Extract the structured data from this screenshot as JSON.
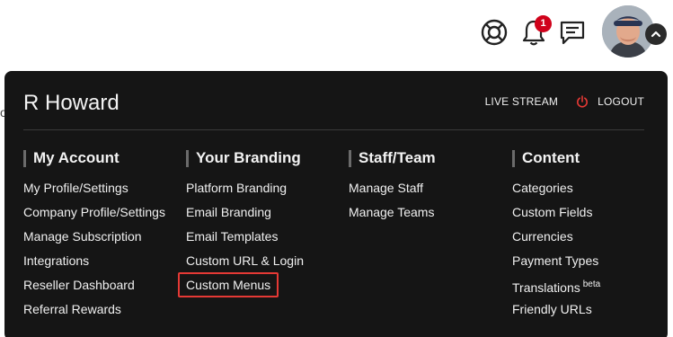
{
  "topbar": {
    "notification_count": "1",
    "icons": [
      "lifebuoy-icon",
      "bell-icon",
      "chat-icon"
    ]
  },
  "left_stub": "o",
  "menu": {
    "user_name": "R Howard",
    "live_stream": "LIVE STREAM",
    "logout": "LOGOUT",
    "columns": [
      {
        "title": "My Account",
        "items": [
          "My Profile/Settings",
          "Company Profile/Settings",
          "Manage Subscription",
          "Integrations",
          "Reseller Dashboard",
          "Referral Rewards"
        ]
      },
      {
        "title": "Your Branding",
        "items": [
          "Platform Branding",
          "Email Branding",
          "Email Templates",
          "Custom URL & Login",
          "Custom Menus"
        ]
      },
      {
        "title": "Staff/Team",
        "items": [
          "Manage Staff",
          "Manage Teams"
        ]
      },
      {
        "title": "Content",
        "items": [
          "Categories",
          "Custom Fields",
          "Currencies",
          "Payment Types",
          "Translations",
          "Friendly URLs"
        ],
        "translations_badge": "beta"
      }
    ]
  },
  "colors": {
    "background": "#151515",
    "accent_red": "#e53935",
    "badge_red": "#d0021b"
  }
}
